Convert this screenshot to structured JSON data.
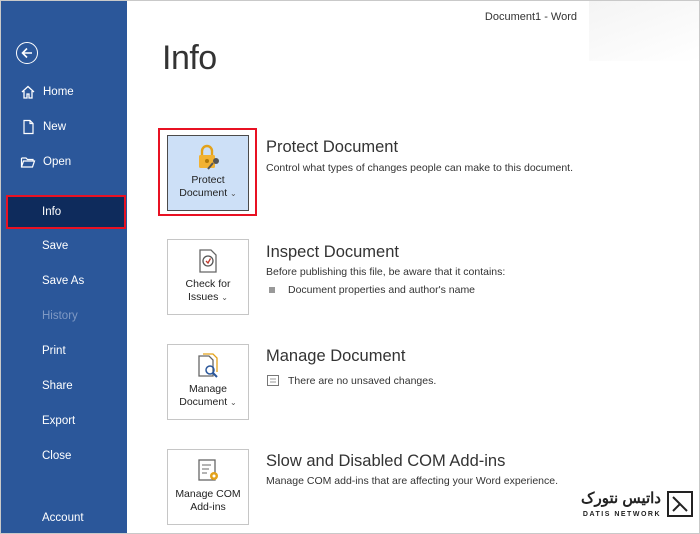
{
  "header": {
    "doc_title": "Document1  -  Word",
    "page_title": "Info"
  },
  "sidebar": {
    "items": [
      {
        "label": "Home",
        "icon": "home-icon"
      },
      {
        "label": "New",
        "icon": "new-document-icon"
      },
      {
        "label": "Open",
        "icon": "open-folder-icon"
      },
      {
        "label": "Info",
        "state": "selected"
      },
      {
        "label": "Save"
      },
      {
        "label": "Save As"
      },
      {
        "label": "History",
        "state": "disabled"
      },
      {
        "label": "Print"
      },
      {
        "label": "Share"
      },
      {
        "label": "Export"
      },
      {
        "label": "Close"
      },
      {
        "label": "Account"
      }
    ]
  },
  "sections": {
    "protect": {
      "button_line1": "Protect",
      "button_line2": "Document",
      "title": "Protect Document",
      "description": "Control what types of changes people can make to this document."
    },
    "inspect": {
      "button_line1": "Check for",
      "button_line2": "Issues",
      "title": "Inspect Document",
      "description": "Before publishing this file, be aware that it contains:",
      "bullet": "Document properties and author's name"
    },
    "manage": {
      "button_line1": "Manage",
      "button_line2": "Document",
      "title": "Manage Document",
      "bullet": "There are no unsaved changes."
    },
    "addins": {
      "button_line1": "Manage COM",
      "button_line2": "Add-ins",
      "title": "Slow and Disabled COM Add-ins",
      "description": "Manage COM add-ins that are affecting your Word experience."
    }
  },
  "watermark": {
    "text": "داتیس نتورک",
    "sub": "DATIS NETWORK"
  },
  "colors": {
    "sidebar": "#2b579a",
    "selected_nav": "#0e2b5c",
    "highlight": "#e81123",
    "selected_button": "#cde0f7"
  }
}
